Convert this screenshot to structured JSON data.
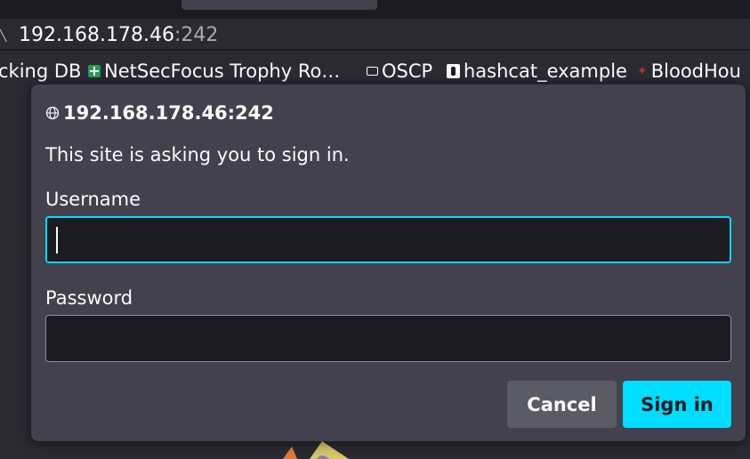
{
  "browser": {
    "url_host": "192.168.178.46",
    "url_port": ":242",
    "bookmarks": [
      {
        "label": "cking DB",
        "icon": "none"
      },
      {
        "label": "NetSecFocus Trophy Ro…",
        "icon": "spreadsheet-icon"
      },
      {
        "label": "OSCP",
        "icon": "folder-icon"
      },
      {
        "label": "hashcat_example",
        "icon": "hashcat-icon"
      },
      {
        "label": "BloodHou",
        "icon": "bloodhound-icon"
      }
    ]
  },
  "dialog": {
    "origin": "192.168.178.46:242",
    "message": "This site is asking you to sign in.",
    "username_label": "Username",
    "username_value": "",
    "password_label": "Password",
    "password_value": "",
    "cancel_label": "Cancel",
    "signin_label": "Sign in"
  },
  "colors": {
    "accent": "#00ddff",
    "dialog_bg": "#42414d",
    "toolbar_bg": "#1c1b22",
    "page_bg": "#2b2a33"
  }
}
